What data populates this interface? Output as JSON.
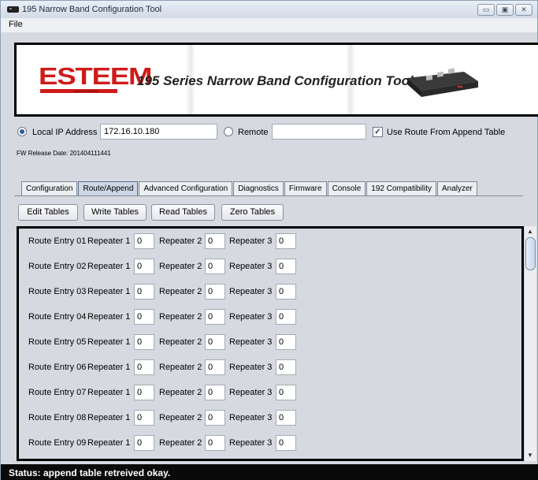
{
  "window": {
    "title": "195 Narrow Band Configuration Tool"
  },
  "menu": {
    "file": "File"
  },
  "window_controls": {
    "minimize": "▭",
    "maximize": "▣",
    "close": "✕"
  },
  "banner": {
    "logo": "ESTEEM",
    "logo_sub": "Wireless Modems",
    "title": "195 Series Narrow Band Configuration Tool"
  },
  "address": {
    "local_label": "Local IP Address",
    "local_value": "172.16.10.180",
    "remote_label": "Remote",
    "remote_value": "",
    "local_selected": true,
    "use_route_label": "Use Route From Append Table",
    "use_route_checked": true,
    "fw_release": "FW Release Date: 201404111441"
  },
  "tabs": [
    {
      "label": "Configuration",
      "active": false
    },
    {
      "label": "Route/Append",
      "active": true
    },
    {
      "label": "Advanced Configuration",
      "active": false
    },
    {
      "label": "Diagnostics",
      "active": false
    },
    {
      "label": "Firmware",
      "active": false
    },
    {
      "label": "Console",
      "active": false
    },
    {
      "label": "192 Compatibility",
      "active": false
    },
    {
      "label": "Analyzer",
      "active": false
    }
  ],
  "buttons": {
    "edit": "Edit Tables",
    "write": "Write Tables",
    "read": "Read Tables",
    "zero": "Zero Tables"
  },
  "routes": {
    "repeater1_label": "Repeater 1",
    "repeater2_label": "Repeater 2",
    "repeater3_label": "Repeater 3",
    "entries": [
      {
        "label": "Route Entry 01",
        "r1": "0",
        "r2": "0",
        "r3": "0"
      },
      {
        "label": "Route Entry 02",
        "r1": "0",
        "r2": "0",
        "r3": "0"
      },
      {
        "label": "Route Entry 03",
        "r1": "0",
        "r2": "0",
        "r3": "0"
      },
      {
        "label": "Route Entry 04",
        "r1": "0",
        "r2": "0",
        "r3": "0"
      },
      {
        "label": "Route Entry 05",
        "r1": "0",
        "r2": "0",
        "r3": "0"
      },
      {
        "label": "Route Entry 06",
        "r1": "0",
        "r2": "0",
        "r3": "0"
      },
      {
        "label": "Route Entry 07",
        "r1": "0",
        "r2": "0",
        "r3": "0"
      },
      {
        "label": "Route Entry 08",
        "r1": "0",
        "r2": "0",
        "r3": "0"
      },
      {
        "label": "Route Entry 09",
        "r1": "0",
        "r2": "0",
        "r3": "0"
      }
    ]
  },
  "status": {
    "text": "Status: append table retreived okay."
  },
  "icons": {
    "app": "app-icon",
    "scroll_up": "▲",
    "scroll_down": "▼"
  }
}
